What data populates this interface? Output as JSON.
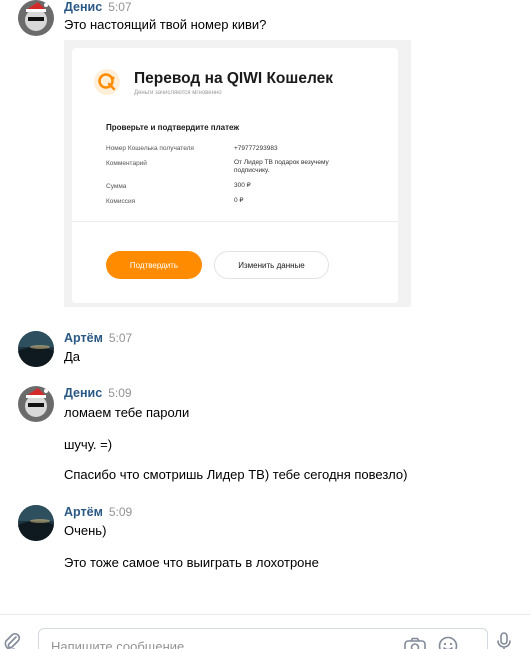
{
  "messages": [
    {
      "author": "Денис",
      "time": "5:07",
      "texts": [
        "Это настоящий твой номер киви?"
      ]
    },
    {
      "author": "Артём",
      "time": "5:07",
      "texts": [
        "Да"
      ]
    },
    {
      "author": "Денис",
      "time": "5:09",
      "texts": [
        "ломаем тебе пароли",
        "шучу. =)",
        "Спасибо что смотришь Лидер ТВ) тебе сегодня повезло)"
      ]
    },
    {
      "author": "Артём",
      "time": "5:09",
      "texts": [
        "Очень)",
        "Это тоже самое что выиграть в лохотроне"
      ]
    }
  ],
  "qiwi": {
    "title": "Перевод на QIWI Кошелек",
    "subtitle": "Деньги зачисляются мгновенно",
    "heading": "Проверьте и подтвердите платеж",
    "rows": [
      {
        "label": "Номер Кошелька получателя",
        "value": "+79777293983"
      },
      {
        "label": "Комментарий",
        "value": "От Лидер ТВ подарок везучему подписчику."
      },
      {
        "label": "Сумма",
        "value": "300 ₽"
      },
      {
        "label": "Комиссия",
        "value": "0 ₽"
      }
    ],
    "confirm_label": "Подтвердить",
    "change_label": "Изменить данные",
    "accent_color": "#ff8c00"
  },
  "composer": {
    "placeholder": "Напишите сообщение..."
  },
  "colors": {
    "author": "#2a5885",
    "time": "#939393"
  }
}
